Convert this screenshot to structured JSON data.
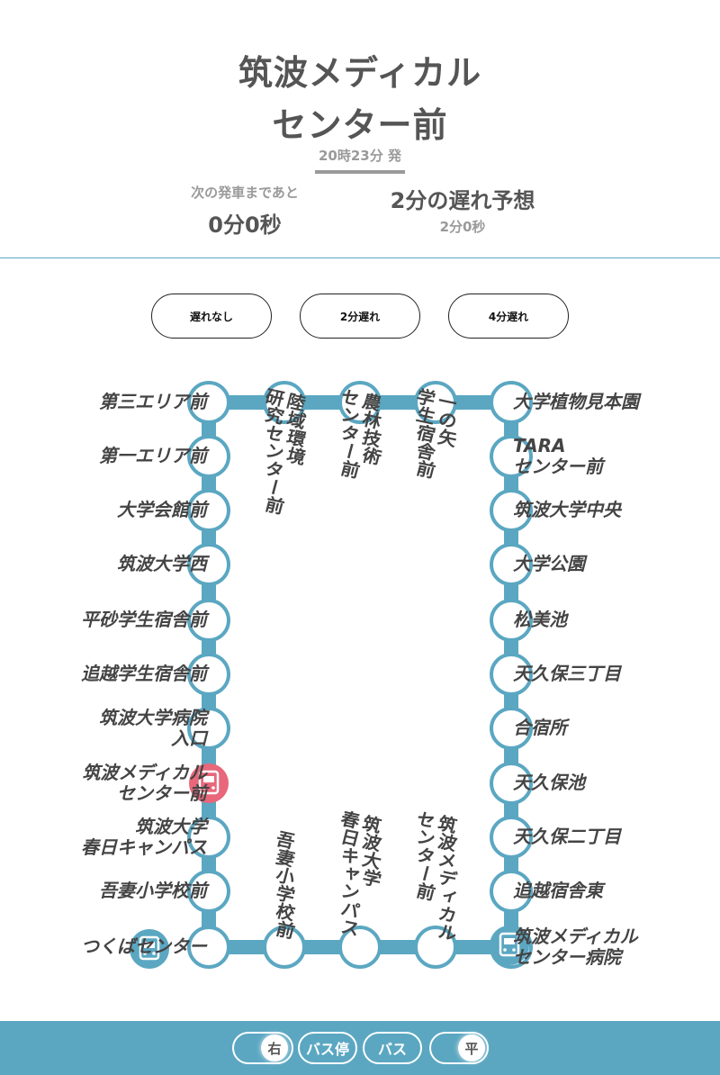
{
  "header": {
    "title_line1": "筑波メディカル",
    "title_line2": "センター前",
    "departure": "20時23分 発",
    "countdown_label": "次の発車まであと",
    "countdown_value": "0分0秒",
    "delay_title": "2分の遅れ予想",
    "delay_sub": "2分0秒"
  },
  "delay_buttons": [
    "遅れなし",
    "2分遅れ",
    "4分遅れ"
  ],
  "colors": {
    "route": "#5ba7c2",
    "current_stop": "#e8677a",
    "text_dark": "#555555",
    "text_light": "#9a9a9a"
  },
  "stops": {
    "left": [
      "第三エリア前",
      "第一エリア前",
      "大学会館前",
      "筑波大学西",
      "平砂学生宿舎前",
      "追越学生宿舎前",
      "筑波大学病院\n入口",
      "筑波メディカル\nセンター前",
      "筑波大学\n春日キャンパス",
      "吾妻小学校前",
      "つくばセンター"
    ],
    "top": [
      "陸域環境\n研究センター前",
      "農林技術\nセンター前",
      "一の矢\n学生宿舎前"
    ],
    "right": [
      "大学植物見本園",
      "TARA\nセンター前",
      "筑波大学中央",
      "大学公園",
      "松美池",
      "天久保三丁目",
      "合宿所",
      "天久保池",
      "天久保二丁目",
      "追越宿舎東",
      "筑波メディカル\nセンター病院"
    ],
    "bottom": [
      "吾妻小学校前",
      "筑波大学\n春日キャンパス",
      "筑波メディカル\nセンター前"
    ]
  },
  "footer": {
    "left_toggle": "右",
    "bus_stop": "バス停",
    "bus": "バス",
    "right_toggle": "平"
  }
}
